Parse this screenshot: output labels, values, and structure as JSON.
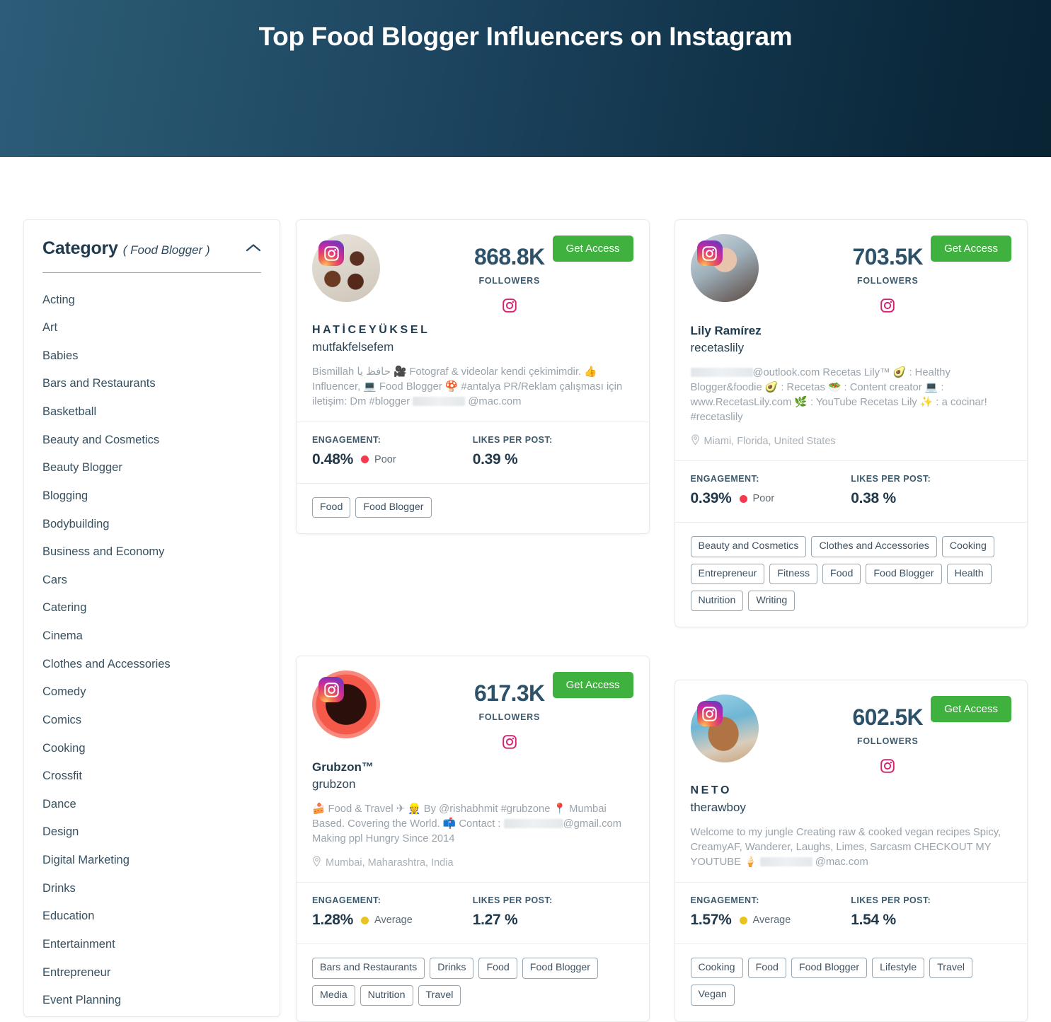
{
  "header": {
    "title": "Top Food Blogger Influencers on Instagram",
    "gradient_from": "#2d5e7c",
    "gradient_to": "#08222f"
  },
  "sidebar": {
    "title": "Category",
    "subtitle": "( Food Blogger )",
    "chevron_icon": "chevron-up-icon",
    "items": [
      "Acting",
      "Art",
      "Babies",
      "Bars and Restaurants",
      "Basketball",
      "Beauty and Cosmetics",
      "Beauty Blogger",
      "Blogging",
      "Bodybuilding",
      "Business and Economy",
      "Cars",
      "Catering",
      "Cinema",
      "Clothes and Accessories",
      "Comedy",
      "Comics",
      "Cooking",
      "Crossfit",
      "Dance",
      "Design",
      "Digital Marketing",
      "Drinks",
      "Education",
      "Entertainment",
      "Entrepreneur",
      "Event Planning"
    ]
  },
  "labels": {
    "followers": "FOLLOWERS",
    "engagement": "ENGAGEMENT:",
    "likes_per_post": "LIKES PER POST:",
    "get_access": "Get Access"
  },
  "colors": {
    "accent_green": "#3fb13f",
    "poor": "#f6394e",
    "average": "#e9c421",
    "followers_text": "#2c5168"
  },
  "cards": [
    {
      "followers": "868.8K",
      "name": "HATİCEYÜKSEL",
      "handle": "mutfakfelsefem",
      "bio_a": "Bismillah حافظ يا 🎥 Fotograf & videolar kendi çekimimdir. 👍 Influencer, 💻 Food Blogger 🍄 #antalya PR/Reklam çalışması için iletişim: Dm #blogger ",
      "bio_b": " @mac.com",
      "location": "",
      "engagement": "0.48%",
      "quality": "Poor",
      "quality_color": "#f6394e",
      "likes_per_post": "0.39 %",
      "tags": [
        "Food",
        "Food Blogger"
      ]
    },
    {
      "followers": "703.5K",
      "name": "Lily Ramírez",
      "handle": "recetaslily",
      "bio_a": "",
      "bio_b": "@outlook.com Recetas Lily™ 🥑 : Healthy Blogger&foodie 🥑 : Recetas 🥗 : Content creator 💻 : www.RecetasLily.com 🌿 : YouTube Recetas Lily ✨ : a cocinar! #recetaslily",
      "location": "Miami, Florida, United States",
      "engagement": "0.39%",
      "quality": "Poor",
      "quality_color": "#f6394e",
      "likes_per_post": "0.38 %",
      "tags": [
        "Beauty and Cosmetics",
        "Clothes and Accessories",
        "Cooking",
        "Entrepreneur",
        "Fitness",
        "Food",
        "Food Blogger",
        "Health",
        "Nutrition",
        "Writing"
      ]
    },
    {
      "followers": "617.3K",
      "name": "Grubzon™",
      "handle": "grubzon",
      "bio_a": "🍰 Food & Travel ✈ 👷 By @rishabhmit #grubzone 📍 Mumbai Based. Covering the World. 📫 Contact : ",
      "bio_b": "@gmail.com Making ppl Hungry Since 2014",
      "location": "Mumbai, Maharashtra, India",
      "engagement": "1.28%",
      "quality": "Average",
      "quality_color": "#e9c421",
      "likes_per_post": "1.27 %",
      "tags": [
        "Bars and Restaurants",
        "Drinks",
        "Food",
        "Food Blogger",
        "Media",
        "Nutrition",
        "Travel"
      ]
    },
    {
      "followers": "602.5K",
      "name": "NETO",
      "handle": "therawboy",
      "bio_a": "Welcome to my jungle Creating raw & cooked vegan recipes Spicy, CreamyAF, Wanderer, Laughs, Limes, Sarcasm CHECKOUT MY YOUTUBE 🍦 ",
      "bio_b": " @mac.com",
      "location": "",
      "engagement": "1.57%",
      "quality": "Average",
      "quality_color": "#e9c421",
      "likes_per_post": "1.54 %",
      "tags": [
        "Cooking",
        "Food",
        "Food Blogger",
        "Lifestyle",
        "Travel",
        "Vegan"
      ]
    }
  ]
}
